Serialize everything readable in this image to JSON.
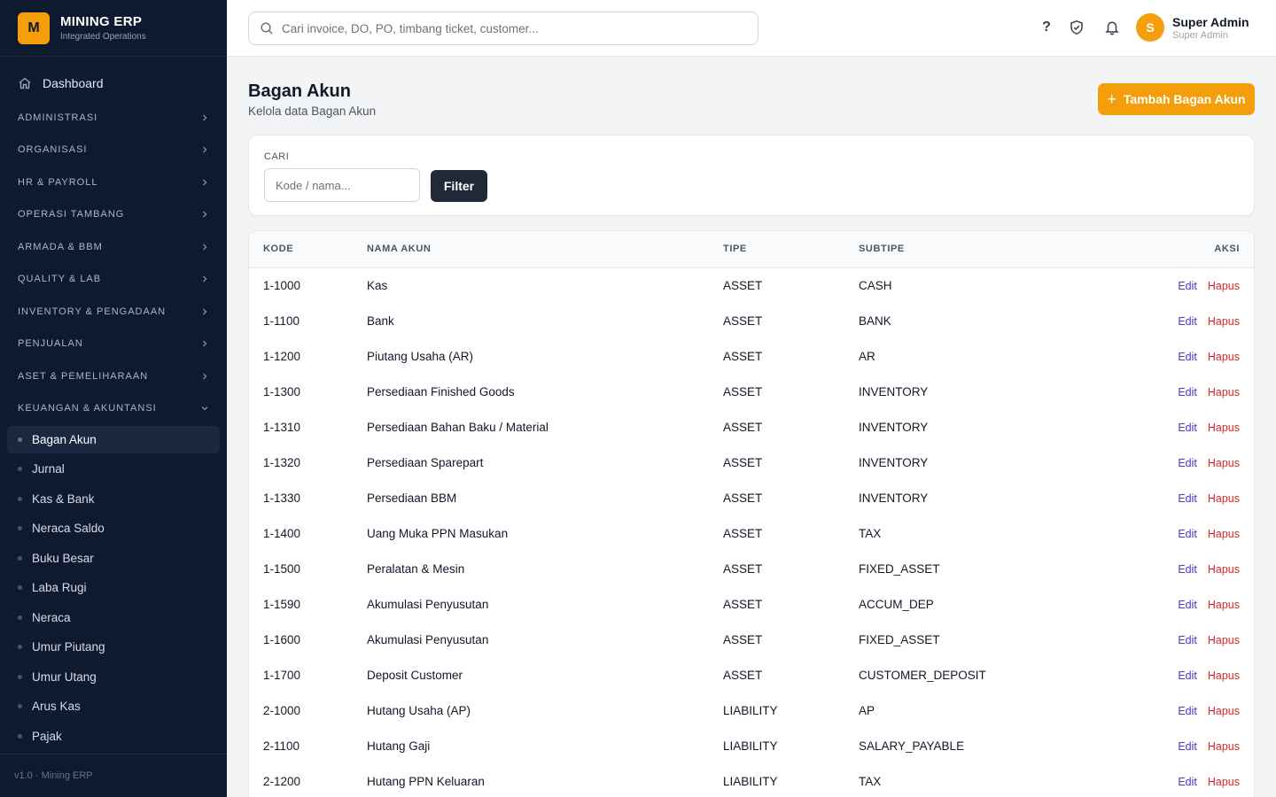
{
  "brand": {
    "logo": "M",
    "title": "MINING ERP",
    "subtitle": "Integrated Operations"
  },
  "sidebar": {
    "dashboard": "Dashboard",
    "groups": [
      "ADMINISTRASI",
      "ORGANISASI",
      "HR & PAYROLL",
      "OPERASI TAMBANG",
      "ARMADA & BBM",
      "QUALITY & LAB",
      "INVENTORY & PENGADAAN",
      "PENJUALAN",
      "ASET & PEMELIHARAAN",
      "KEUANGAN & AKUNTANSI"
    ],
    "finance_items": [
      "Bagan Akun",
      "Jurnal",
      "Kas & Bank",
      "Neraca Saldo",
      "Buku Besar",
      "Laba Rugi",
      "Neraca",
      "Umur Piutang",
      "Umur Utang",
      "Arus Kas",
      "Pajak"
    ],
    "active_item": "Bagan Akun",
    "footer": "v1.0 · Mining ERP"
  },
  "search": {
    "placeholder": "Cari invoice, DO, PO, timbang ticket, customer..."
  },
  "topbar": {
    "help": "?"
  },
  "user": {
    "initial": "S",
    "name": "Super Admin",
    "role": "Super Admin"
  },
  "page": {
    "title": "Bagan Akun",
    "subtitle": "Kelola data Bagan Akun",
    "add_label": "Tambah Bagan Akun"
  },
  "filter": {
    "label": "CARI",
    "placeholder": "Kode / nama...",
    "button": "Filter"
  },
  "table": {
    "headers": {
      "kode": "KODE",
      "nama": "NAMA AKUN",
      "tipe": "TIPE",
      "subtipe": "SUBTIPE",
      "aksi": "AKSI"
    },
    "actions": {
      "edit": "Edit",
      "delete": "Hapus"
    },
    "rows": [
      {
        "kode": "1-1000",
        "nama": "Kas",
        "tipe": "ASSET",
        "subtipe": "CASH"
      },
      {
        "kode": "1-1100",
        "nama": "Bank",
        "tipe": "ASSET",
        "subtipe": "BANK"
      },
      {
        "kode": "1-1200",
        "nama": "Piutang Usaha (AR)",
        "tipe": "ASSET",
        "subtipe": "AR"
      },
      {
        "kode": "1-1300",
        "nama": "Persediaan Finished Goods",
        "tipe": "ASSET",
        "subtipe": "INVENTORY"
      },
      {
        "kode": "1-1310",
        "nama": "Persediaan Bahan Baku / Material",
        "tipe": "ASSET",
        "subtipe": "INVENTORY"
      },
      {
        "kode": "1-1320",
        "nama": "Persediaan Sparepart",
        "tipe": "ASSET",
        "subtipe": "INVENTORY"
      },
      {
        "kode": "1-1330",
        "nama": "Persediaan BBM",
        "tipe": "ASSET",
        "subtipe": "INVENTORY"
      },
      {
        "kode": "1-1400",
        "nama": "Uang Muka PPN Masukan",
        "tipe": "ASSET",
        "subtipe": "TAX"
      },
      {
        "kode": "1-1500",
        "nama": "Peralatan & Mesin",
        "tipe": "ASSET",
        "subtipe": "FIXED_ASSET"
      },
      {
        "kode": "1-1590",
        "nama": "Akumulasi Penyusutan",
        "tipe": "ASSET",
        "subtipe": "ACCUM_DEP"
      },
      {
        "kode": "1-1600",
        "nama": "Akumulasi Penyusutan",
        "tipe": "ASSET",
        "subtipe": "FIXED_ASSET"
      },
      {
        "kode": "1-1700",
        "nama": "Deposit Customer",
        "tipe": "ASSET",
        "subtipe": "CUSTOMER_DEPOSIT"
      },
      {
        "kode": "2-1000",
        "nama": "Hutang Usaha (AP)",
        "tipe": "LIABILITY",
        "subtipe": "AP"
      },
      {
        "kode": "2-1100",
        "nama": "Hutang Gaji",
        "tipe": "LIABILITY",
        "subtipe": "SALARY_PAYABLE"
      },
      {
        "kode": "2-1200",
        "nama": "Hutang PPN Keluaran",
        "tipe": "LIABILITY",
        "subtipe": "TAX"
      }
    ]
  },
  "colors": {
    "sidebar_bg": "#0f1a30",
    "accent": "#f59e0b",
    "edit": "#4338ca",
    "delete": "#dc2626",
    "filter_button": "#1f2937"
  },
  "icons": [
    "home-icon",
    "chevron-right-icon",
    "chevron-down-icon",
    "search-icon",
    "help-icon",
    "shield-check-icon",
    "bell-icon",
    "plus-icon"
  ]
}
